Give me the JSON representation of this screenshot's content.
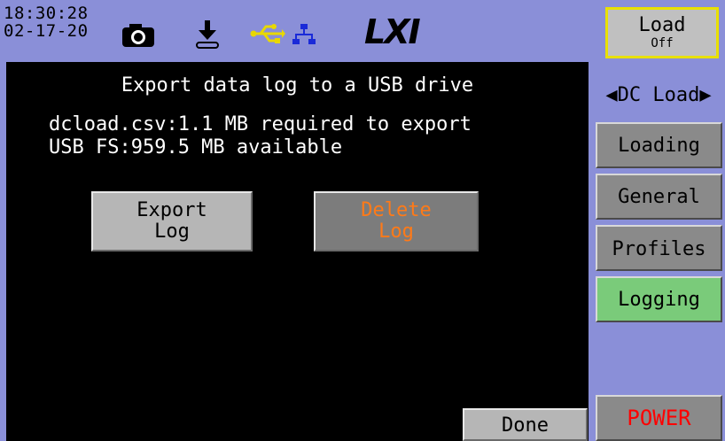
{
  "status": {
    "time": "18:30:28",
    "date": "02-17-20",
    "icons": [
      "camera-icon",
      "download-icon",
      "usb-icon",
      "lan-icon"
    ],
    "logo": "LXI"
  },
  "main": {
    "title": "Export data log to a USB drive",
    "info_line1": "dcload.csv:1.1 MB required to export",
    "info_line2": "USB FS:959.5 MB available",
    "export_button": {
      "line1": "Export",
      "line2": "Log"
    },
    "delete_button": {
      "line1": "Delete",
      "line2": "Log"
    },
    "done_button": "Done"
  },
  "sidebar": {
    "load_key": {
      "label": "Load",
      "state": "Off"
    },
    "menu_title": "◀DC Load▶",
    "items": [
      {
        "label": "Loading"
      },
      {
        "label": "General"
      },
      {
        "label": "Profiles"
      },
      {
        "label": "Logging",
        "active": true
      }
    ],
    "power": "POWER"
  },
  "colors": {
    "background": "#8a8fd8",
    "panel": "#000000",
    "active_key": "#7acb7a",
    "disabled_text": "#ff7a18",
    "power_text": "#ff0000",
    "load_key_border": "#e8e000",
    "usb_icon": "#e8d800",
    "lan_icon": "#1a2ad8"
  }
}
